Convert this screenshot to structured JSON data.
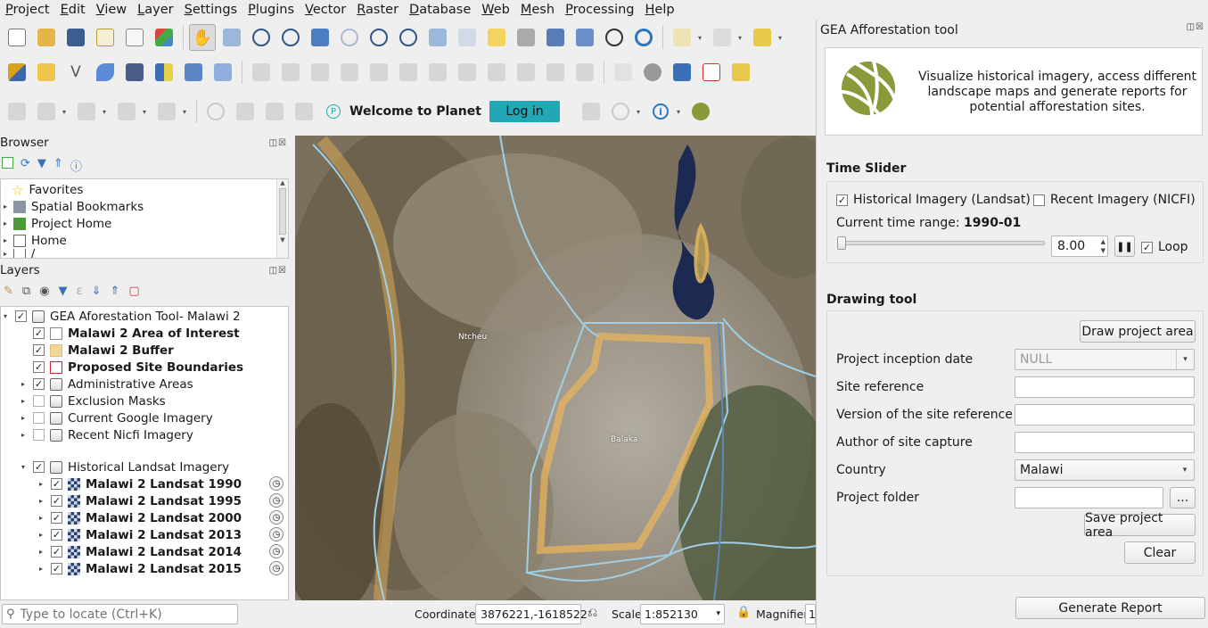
{
  "menu": [
    "Project",
    "Edit",
    "View",
    "Layer",
    "Settings",
    "Plugins",
    "Vector",
    "Raster",
    "Database",
    "Web",
    "Mesh",
    "Processing",
    "Help"
  ],
  "planet": {
    "welcome": "Welcome to Planet",
    "login": "Log in"
  },
  "browser": {
    "title": "Browser",
    "items": [
      "Favorites",
      "Spatial Bookmarks",
      "Project Home",
      "Home",
      "/"
    ]
  },
  "layers": {
    "title": "Layers",
    "group_name": "GEA Aforestation Tool- Malawi 2",
    "items": [
      {
        "label": "Malawi 2 Area of Interest",
        "checked": true,
        "bold": true
      },
      {
        "label": "Malawi 2 Buffer",
        "checked": true,
        "bold": true
      },
      {
        "label": "Proposed Site Boundaries",
        "checked": true,
        "bold": true
      },
      {
        "label": "Administrative Areas",
        "checked": true,
        "bold": false
      },
      {
        "label": "Exclusion Masks",
        "checked": false,
        "bold": false
      },
      {
        "label": "Current Google Imagery",
        "checked": false,
        "bold": false
      },
      {
        "label": "Recent Nicfi Imagery",
        "checked": false,
        "bold": false
      }
    ],
    "landsat_group": "Historical Landsat Imagery",
    "landsat": [
      "Malawi 2 Landsat 1990",
      "Malawi 2 Landsat 1995",
      "Malawi 2 Landsat 2000",
      "Malawi 2 Landsat 2013",
      "Malawi 2 Landsat 2014",
      "Malawi 2 Landsat 2015"
    ]
  },
  "map": {
    "place1": "Ntcheu",
    "place2": "Balaka"
  },
  "plugin": {
    "title": "GEA Afforestation tool",
    "description": "Visualize historical imagery, access different landscape maps and generate reports for potential afforestation sites.",
    "time_slider": {
      "heading": "Time Slider",
      "historical": "Historical Imagery (Landsat)",
      "historical_checked": true,
      "recent": "Recent Imagery (NICFI)",
      "recent_checked": false,
      "range_label": "Current time range:",
      "range_value": "1990-01",
      "speed": "8.00",
      "loop": "Loop",
      "loop_checked": true,
      "position": 0
    },
    "drawing": {
      "heading": "Drawing tool",
      "draw_btn": "Draw project area",
      "fields": [
        {
          "label": "Project inception date",
          "value": "NULL"
        },
        {
          "label": "Site reference",
          "value": ""
        },
        {
          "label": "Version of the site reference",
          "value": ""
        },
        {
          "label": "Author of site capture",
          "value": ""
        },
        {
          "label": "Country",
          "value": "Malawi"
        },
        {
          "label": "Project folder",
          "value": ""
        }
      ],
      "browse": "...",
      "save_btn": "Save project area",
      "clear_btn": "Clear"
    },
    "generate_btn": "Generate Report"
  },
  "status": {
    "locate_placeholder": "Type to locate (Ctrl+K)",
    "coordinate_label": "Coordinate",
    "coordinate": "3876221,-1618522",
    "scale_label": "Scale",
    "scale": "1:852130",
    "magnifier_label": "Magnifier",
    "magnifier": "1"
  },
  "colors": {
    "accent": "#22a7b4",
    "logo": "#8a9a3a"
  }
}
